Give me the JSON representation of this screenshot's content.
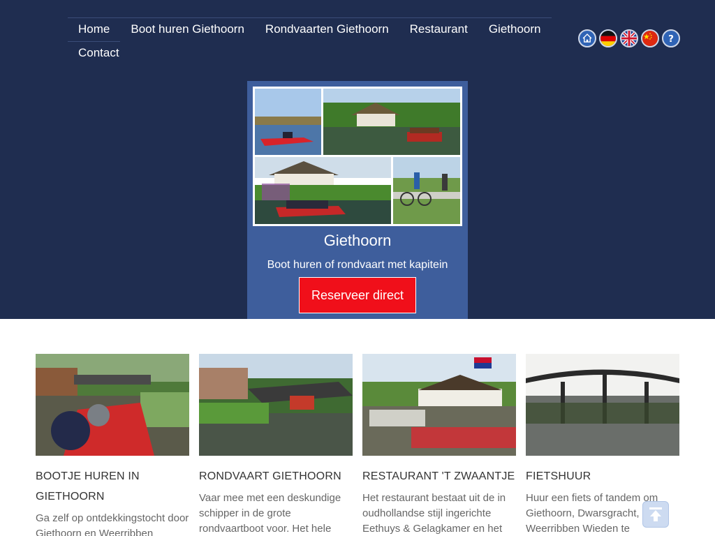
{
  "nav": {
    "items": [
      {
        "label": "Home"
      },
      {
        "label": "Boot huren Giethoorn"
      },
      {
        "label": "Rondvaarten Giethoorn"
      },
      {
        "label": "Restaurant"
      },
      {
        "label": "Giethoorn"
      },
      {
        "label": "Contact"
      }
    ]
  },
  "icons": [
    "home-icon",
    "flag-de-icon",
    "flag-uk-icon",
    "flag-cn-icon",
    "help-icon"
  ],
  "hero": {
    "title": "Giethoorn",
    "subtitle": "Boot huren of rondvaart met kapitein",
    "cta_label": "Reserveer direct"
  },
  "cards": [
    {
      "title": "BOOTJE HUREN IN GIETHOORN",
      "text": "Ga zelf op ontdekkingstocht door Giethoorn en Weerribben"
    },
    {
      "title": "RONDVAART GIETHOORN",
      "text": "Vaar mee met een deskundige schipper in de grote rondvaartboot voor. Het hele"
    },
    {
      "title": "RESTAURANT 'T ZWAANTJE",
      "text": "Het restaurant bestaat uit de in oudhollandse stijl ingerichte Eethuys & Gelagkamer en het"
    },
    {
      "title": "FIETSHUUR",
      "text": "Huur een fiets of tandem om Giethoorn, Dwarsgracht, Weerribben Wieden te"
    }
  ],
  "colors": {
    "header_bg": "#1f2d50",
    "hero_bg": "#3e5e9c",
    "cta_bg": "#f00f1a"
  }
}
